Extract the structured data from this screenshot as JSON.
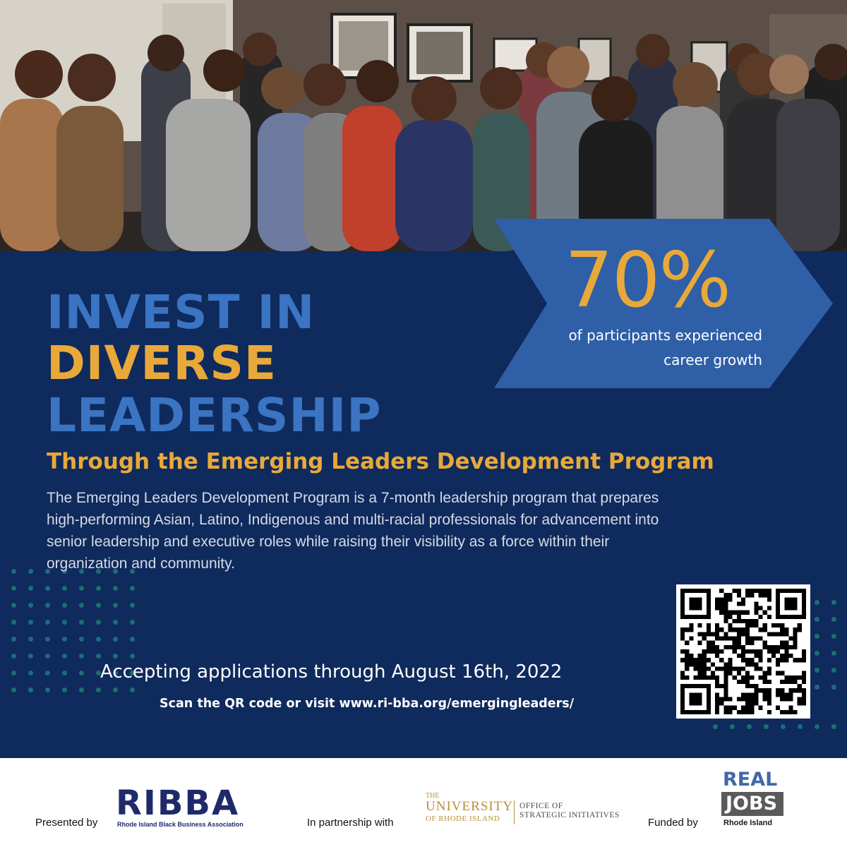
{
  "stat": {
    "value": "70%",
    "caption_line1": "of participants experienced",
    "caption_line2": "career growth"
  },
  "headline": {
    "line1": "INVEST IN",
    "line2": "DIVERSE",
    "line3": "LEADERSHIP"
  },
  "subheadline": "Through the Emerging Leaders  Development Program",
  "description": "The Emerging Leaders Development Program  is a 7-month leadership program that prepares high-performing Asian, Latino, Indigenous and multi-racial professionals for advancement into senior leadership and executive roles while raising their visibility as a force within their organization and community.",
  "cta": {
    "deadline": "Accepting applications through August 16th, 2022",
    "visit": "Scan the QR code or visit www.ri-bba.org/emergingleaders/"
  },
  "footer": {
    "presented_by": "Presented by",
    "ribba_name": "RIBBA",
    "ribba_full": "Rhode Island Black Business Association",
    "partnership": "In partnership with",
    "uri_the": "THE",
    "uri_university": "UNIVERSITY",
    "uri_of_ri": "OF RHODE ISLAND",
    "uri_office_line1": "OFFICE OF",
    "uri_office_line2": "STRATEGIC INITIATIVES",
    "funded_by": "Funded by",
    "rj_real": "REAL",
    "rj_jobs": "JOBS",
    "rj_ri": "Rhode Island"
  },
  "colors": {
    "navy": "#0f2a5c",
    "blue_headline": "#3a74c2",
    "gold": "#e8a93a",
    "arrow": "#2f5fa6",
    "dots": "#1d6e73"
  },
  "icons": {
    "qr": "qr-code",
    "arrow": "chevron-arrow-banner"
  }
}
